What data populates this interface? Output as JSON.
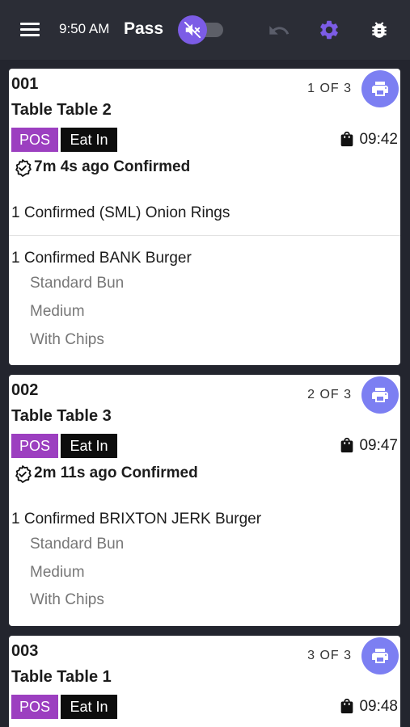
{
  "header": {
    "time": "9:50 AM",
    "station": "Pass",
    "mute_toggle_on": false
  },
  "orders": [
    {
      "number": "001",
      "table": "Table Table 2",
      "of": "1 OF 3",
      "badges": [
        "POS",
        "Eat In"
      ],
      "due": "09:42",
      "status": "7m 4s ago Confirmed",
      "items": [
        {
          "line": "1 Confirmed (SML) Onion Rings",
          "mods": []
        },
        {
          "line": "1 Confirmed BANK Burger",
          "mods": [
            "Standard Bun",
            "Medium",
            "With Chips"
          ]
        }
      ]
    },
    {
      "number": "002",
      "table": "Table Table 3",
      "of": "2 OF 3",
      "badges": [
        "POS",
        "Eat In"
      ],
      "due": "09:47",
      "status": "2m 11s ago Confirmed",
      "items": [
        {
          "line": "1 Confirmed BRIXTON JERK Burger",
          "mods": [
            "Standard Bun",
            "Medium",
            "With Chips"
          ]
        }
      ]
    },
    {
      "number": "003",
      "table": "Table Table 1",
      "of": "3 OF 3",
      "badges": [
        "POS",
        "Eat In"
      ],
      "due": "09:48"
    }
  ],
  "colors": {
    "topbar": "#2b2d36",
    "background": "#23252e",
    "accent": "#7c5ce6",
    "print_button": "#7c7ff2",
    "pos_badge": "#9c3fc0",
    "eat_in_badge": "#0d0d0d"
  },
  "icons": {
    "menu": "hamburger-menu-icon",
    "mute": "volume-off-icon",
    "undo": "undo-icon",
    "settings": "gear-icon",
    "debug": "bug-icon",
    "print": "printer-icon",
    "bag": "shopping-bag-icon",
    "confirmed": "verified-badge-icon"
  }
}
